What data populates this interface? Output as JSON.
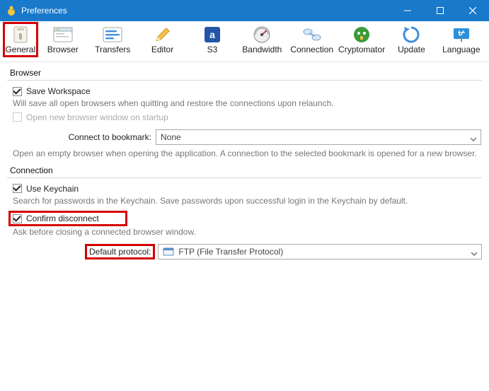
{
  "window": {
    "title": "Preferences"
  },
  "toolbar": {
    "general": "General",
    "browser": "Browser",
    "transfers": "Transfers",
    "editor": "Editor",
    "s3": "S3",
    "bandwidth": "Bandwidth",
    "connection": "Connection",
    "cryptomator": "Cryptomator",
    "update": "Update",
    "language": "Language"
  },
  "browser_section": {
    "title": "Browser",
    "save_workspace": "Save Workspace",
    "save_workspace_desc": "Will save all open browsers when quitting and restore the connections upon relaunch.",
    "open_new": "Open new browser window on startup",
    "connect_bookmark_label": "Connect to bookmark:",
    "connect_bookmark_value": "None",
    "connect_bookmark_desc": "Open an empty browser when opening the application. A connection to the selected bookmark is opened for a new browser."
  },
  "connection_section": {
    "title": "Connection",
    "use_keychain": "Use Keychain",
    "use_keychain_desc": "Search for passwords in the Keychain. Save passwords upon successful login in the Keychain by default.",
    "confirm_disconnect": "Confirm disconnect",
    "confirm_disconnect_desc": "Ask before closing a connected browser window.",
    "default_protocol_label": "Default protocol:",
    "default_protocol_value": "FTP (File Transfer Protocol)"
  }
}
